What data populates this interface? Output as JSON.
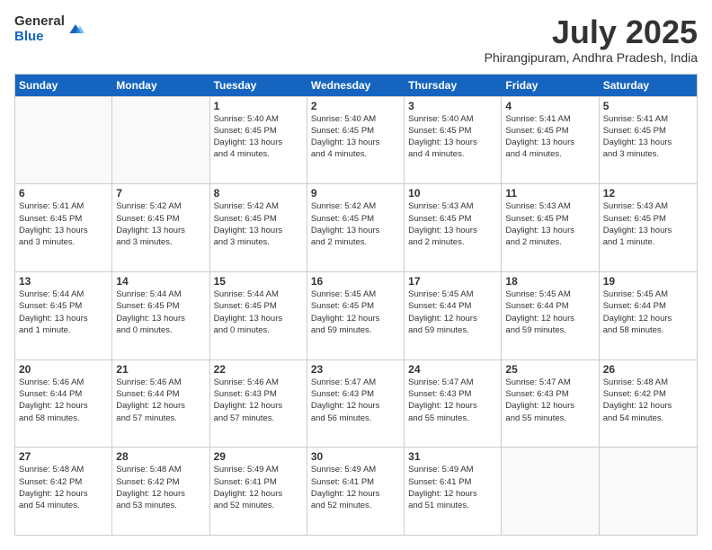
{
  "logo": {
    "general": "General",
    "blue": "Blue"
  },
  "title": "July 2025",
  "location": "Phirangipuram, Andhra Pradesh, India",
  "weekdays": [
    "Sunday",
    "Monday",
    "Tuesday",
    "Wednesday",
    "Thursday",
    "Friday",
    "Saturday"
  ],
  "rows": [
    [
      {
        "day": "",
        "info": ""
      },
      {
        "day": "",
        "info": ""
      },
      {
        "day": "1",
        "info": "Sunrise: 5:40 AM\nSunset: 6:45 PM\nDaylight: 13 hours\nand 4 minutes."
      },
      {
        "day": "2",
        "info": "Sunrise: 5:40 AM\nSunset: 6:45 PM\nDaylight: 13 hours\nand 4 minutes."
      },
      {
        "day": "3",
        "info": "Sunrise: 5:40 AM\nSunset: 6:45 PM\nDaylight: 13 hours\nand 4 minutes."
      },
      {
        "day": "4",
        "info": "Sunrise: 5:41 AM\nSunset: 6:45 PM\nDaylight: 13 hours\nand 4 minutes."
      },
      {
        "day": "5",
        "info": "Sunrise: 5:41 AM\nSunset: 6:45 PM\nDaylight: 13 hours\nand 3 minutes."
      }
    ],
    [
      {
        "day": "6",
        "info": "Sunrise: 5:41 AM\nSunset: 6:45 PM\nDaylight: 13 hours\nand 3 minutes."
      },
      {
        "day": "7",
        "info": "Sunrise: 5:42 AM\nSunset: 6:45 PM\nDaylight: 13 hours\nand 3 minutes."
      },
      {
        "day": "8",
        "info": "Sunrise: 5:42 AM\nSunset: 6:45 PM\nDaylight: 13 hours\nand 3 minutes."
      },
      {
        "day": "9",
        "info": "Sunrise: 5:42 AM\nSunset: 6:45 PM\nDaylight: 13 hours\nand 2 minutes."
      },
      {
        "day": "10",
        "info": "Sunrise: 5:43 AM\nSunset: 6:45 PM\nDaylight: 13 hours\nand 2 minutes."
      },
      {
        "day": "11",
        "info": "Sunrise: 5:43 AM\nSunset: 6:45 PM\nDaylight: 13 hours\nand 2 minutes."
      },
      {
        "day": "12",
        "info": "Sunrise: 5:43 AM\nSunset: 6:45 PM\nDaylight: 13 hours\nand 1 minute."
      }
    ],
    [
      {
        "day": "13",
        "info": "Sunrise: 5:44 AM\nSunset: 6:45 PM\nDaylight: 13 hours\nand 1 minute."
      },
      {
        "day": "14",
        "info": "Sunrise: 5:44 AM\nSunset: 6:45 PM\nDaylight: 13 hours\nand 0 minutes."
      },
      {
        "day": "15",
        "info": "Sunrise: 5:44 AM\nSunset: 6:45 PM\nDaylight: 13 hours\nand 0 minutes."
      },
      {
        "day": "16",
        "info": "Sunrise: 5:45 AM\nSunset: 6:45 PM\nDaylight: 12 hours\nand 59 minutes."
      },
      {
        "day": "17",
        "info": "Sunrise: 5:45 AM\nSunset: 6:44 PM\nDaylight: 12 hours\nand 59 minutes."
      },
      {
        "day": "18",
        "info": "Sunrise: 5:45 AM\nSunset: 6:44 PM\nDaylight: 12 hours\nand 59 minutes."
      },
      {
        "day": "19",
        "info": "Sunrise: 5:45 AM\nSunset: 6:44 PM\nDaylight: 12 hours\nand 58 minutes."
      }
    ],
    [
      {
        "day": "20",
        "info": "Sunrise: 5:46 AM\nSunset: 6:44 PM\nDaylight: 12 hours\nand 58 minutes."
      },
      {
        "day": "21",
        "info": "Sunrise: 5:46 AM\nSunset: 6:44 PM\nDaylight: 12 hours\nand 57 minutes."
      },
      {
        "day": "22",
        "info": "Sunrise: 5:46 AM\nSunset: 6:43 PM\nDaylight: 12 hours\nand 57 minutes."
      },
      {
        "day": "23",
        "info": "Sunrise: 5:47 AM\nSunset: 6:43 PM\nDaylight: 12 hours\nand 56 minutes."
      },
      {
        "day": "24",
        "info": "Sunrise: 5:47 AM\nSunset: 6:43 PM\nDaylight: 12 hours\nand 55 minutes."
      },
      {
        "day": "25",
        "info": "Sunrise: 5:47 AM\nSunset: 6:43 PM\nDaylight: 12 hours\nand 55 minutes."
      },
      {
        "day": "26",
        "info": "Sunrise: 5:48 AM\nSunset: 6:42 PM\nDaylight: 12 hours\nand 54 minutes."
      }
    ],
    [
      {
        "day": "27",
        "info": "Sunrise: 5:48 AM\nSunset: 6:42 PM\nDaylight: 12 hours\nand 54 minutes."
      },
      {
        "day": "28",
        "info": "Sunrise: 5:48 AM\nSunset: 6:42 PM\nDaylight: 12 hours\nand 53 minutes."
      },
      {
        "day": "29",
        "info": "Sunrise: 5:49 AM\nSunset: 6:41 PM\nDaylight: 12 hours\nand 52 minutes."
      },
      {
        "day": "30",
        "info": "Sunrise: 5:49 AM\nSunset: 6:41 PM\nDaylight: 12 hours\nand 52 minutes."
      },
      {
        "day": "31",
        "info": "Sunrise: 5:49 AM\nSunset: 6:41 PM\nDaylight: 12 hours\nand 51 minutes."
      },
      {
        "day": "",
        "info": ""
      },
      {
        "day": "",
        "info": ""
      }
    ]
  ]
}
